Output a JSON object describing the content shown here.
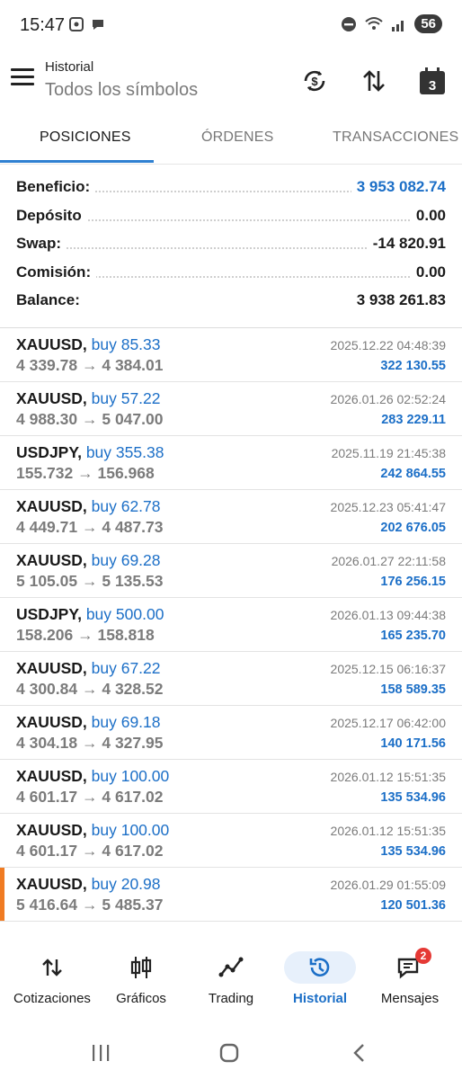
{
  "status_bar": {
    "time": "15:47",
    "battery": "56"
  },
  "app_bar": {
    "title": "Historial",
    "subtitle": "Todos los símbolos",
    "calendar_day": "3"
  },
  "tabs": [
    {
      "label": "POSICIONES",
      "active": true
    },
    {
      "label": "ÓRDENES",
      "active": false
    },
    {
      "label": "TRANSACCIONES",
      "active": false
    }
  ],
  "summary": {
    "profit_label": "Beneficio:",
    "profit_value": "3 953 082.74",
    "deposit_label": "Depósito",
    "deposit_value": "0.00",
    "swap_label": "Swap:",
    "swap_value": "-14 820.91",
    "commission_label": "Comisión:",
    "commission_value": "0.00",
    "balance_label": "Balance:",
    "balance_value": "3 938 261.83"
  },
  "positions": [
    {
      "symbol": "XAUUSD,",
      "type": "buy 85.33",
      "prices": "4 339.78 → 4 384.01",
      "time": "2025.12.22 04:48:39",
      "profit": "322 130.55"
    },
    {
      "symbol": "XAUUSD,",
      "type": "buy 57.22",
      "prices": "4 988.30 → 5 047.00",
      "time": "2026.01.26 02:52:24",
      "profit": "283 229.11"
    },
    {
      "symbol": "USDJPY,",
      "type": "buy 355.38",
      "prices": "155.732 → 156.968",
      "time": "2025.11.19 21:45:38",
      "profit": "242 864.55"
    },
    {
      "symbol": "XAUUSD,",
      "type": "buy 62.78",
      "prices": "4 449.71 → 4 487.73",
      "time": "2025.12.23 05:41:47",
      "profit": "202 676.05"
    },
    {
      "symbol": "XAUUSD,",
      "type": "buy 69.28",
      "prices": "5 105.05 → 5 135.53",
      "time": "2026.01.27 22:11:58",
      "profit": "176 256.15"
    },
    {
      "symbol": "USDJPY,",
      "type": "buy 500.00",
      "prices": "158.206 → 158.818",
      "time": "2026.01.13 09:44:38",
      "profit": "165 235.70"
    },
    {
      "symbol": "XAUUSD,",
      "type": "buy 67.22",
      "prices": "4 300.84 → 4 328.52",
      "time": "2025.12.15 06:16:37",
      "profit": "158 589.35"
    },
    {
      "symbol": "XAUUSD,",
      "type": "buy 69.18",
      "prices": "4 304.18 → 4 327.95",
      "time": "2025.12.17 06:42:00",
      "profit": "140 171.56"
    },
    {
      "symbol": "XAUUSD,",
      "type": "buy 100.00",
      "prices": "4 601.17 → 4 617.02",
      "time": "2026.01.12 15:51:35",
      "profit": "135 534.96"
    },
    {
      "symbol": "XAUUSD,",
      "type": "buy 100.00",
      "prices": "4 601.17 → 4 617.02",
      "time": "2026.01.12 15:51:35",
      "profit": "135 534.96"
    },
    {
      "symbol": "XAUUSD,",
      "type": "buy 20.98",
      "prices": "5 416.64 → 5 485.37",
      "time": "2026.01.29 01:55:09",
      "profit": "120 501.36"
    }
  ],
  "bottom_nav": {
    "quotes": "Cotizaciones",
    "charts": "Gráficos",
    "trading": "Trading",
    "history": "Historial",
    "messages": "Mensajes",
    "messages_badge": "2"
  },
  "colors": {
    "accent": "#1c6fc7",
    "tab_indicator": "#2f80d1",
    "marker": "#f07b22",
    "badge": "#e53935"
  },
  "icons": {
    "menu": "hamburger-icon",
    "sync": "currency-sync-icon",
    "sort": "sort-arrows-icon",
    "calendar": "calendar-icon"
  }
}
